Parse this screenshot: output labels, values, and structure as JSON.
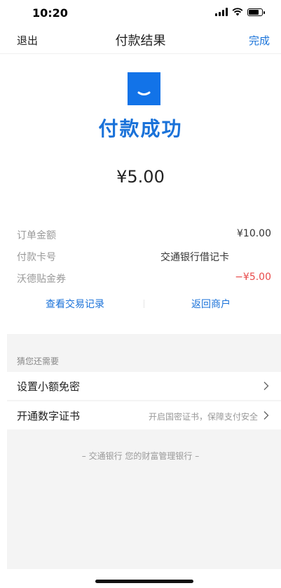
{
  "status_bar": {
    "time": "10:20",
    "battery_level": 0.85
  },
  "nav": {
    "back_label": "退出",
    "title": "付款结果",
    "done_label": "完成"
  },
  "result": {
    "logo_icon": "smile-logo-icon",
    "title": "付款成功",
    "amount": "¥5.00"
  },
  "details": [
    {
      "label": "订单金额",
      "value": "¥10.00"
    },
    {
      "label": "付款卡号",
      "value": "交通银行借记卡"
    },
    {
      "label": "沃德贴金券",
      "value": "−¥5.00"
    }
  ],
  "links": {
    "view_records": "查看交易记录",
    "return_merchant": "返回商户"
  },
  "suggestions": {
    "title": "猜您还需要",
    "items": [
      {
        "label": "设置小额免密",
        "hint": ""
      },
      {
        "label": "开通数字证书",
        "hint": "开启国密证书，保障支付安全"
      }
    ]
  },
  "footer": {
    "text": "– 交通银行 您的财富管理银行 –"
  },
  "colors": {
    "accent": "#1a72d9",
    "negative": "#e84a4a",
    "logo": "#1273e8"
  }
}
